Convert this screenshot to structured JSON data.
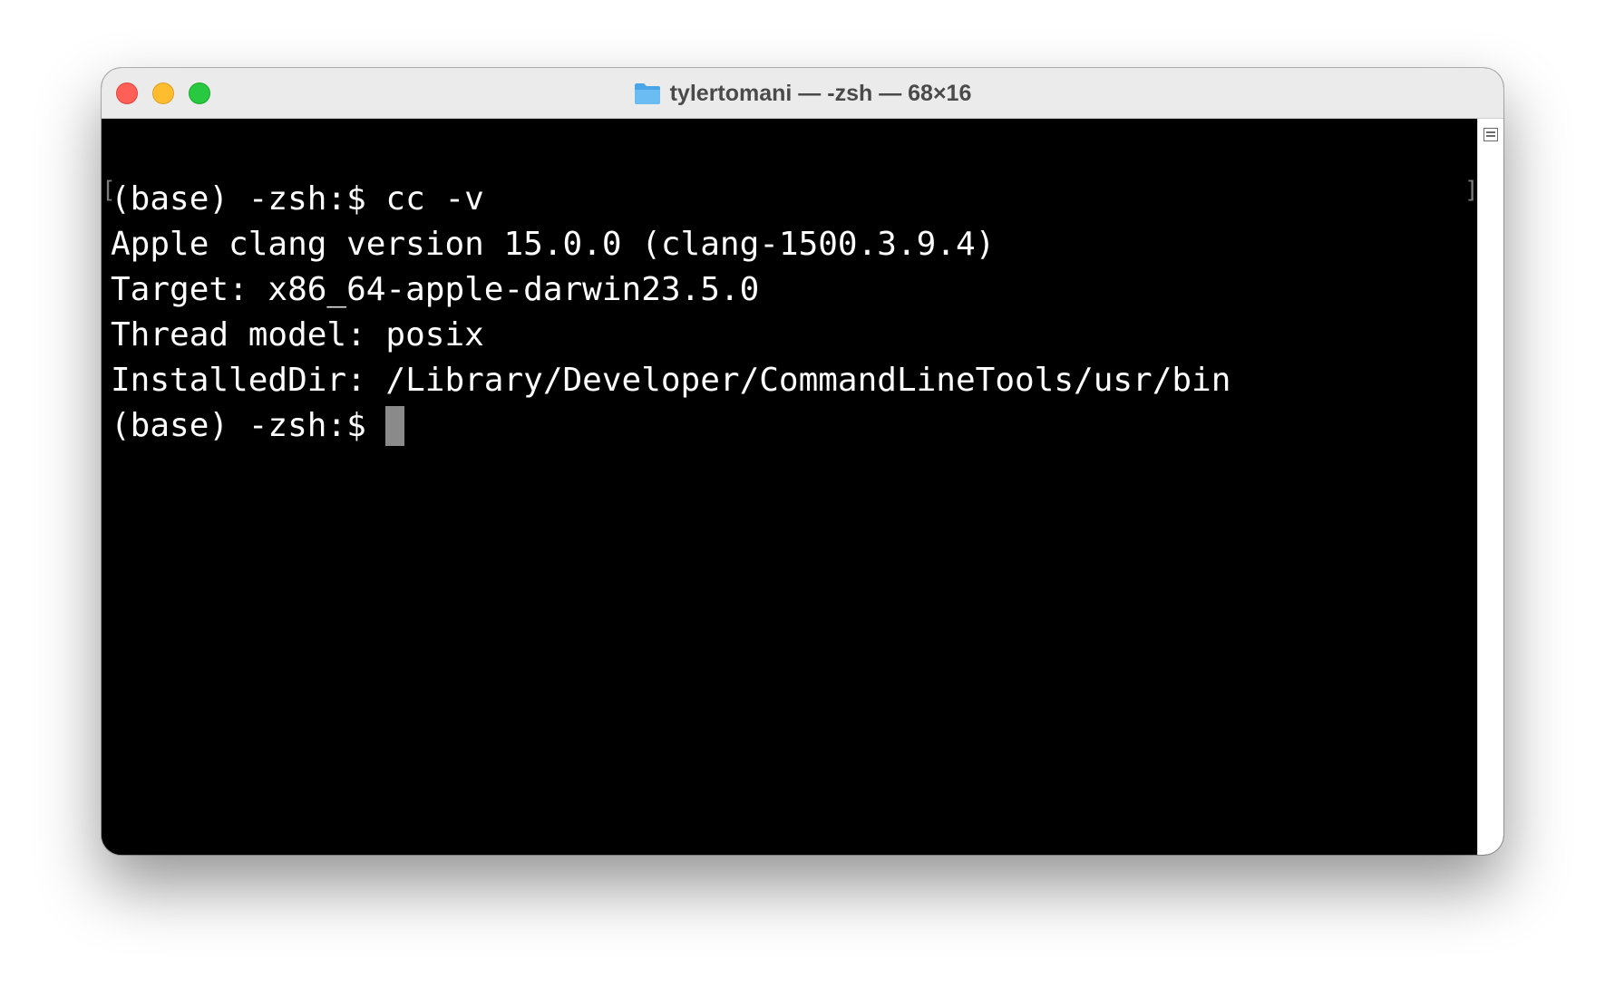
{
  "window": {
    "title": "tylertomani — -zsh — 68×16",
    "title_icon": "folder-icon",
    "controls": {
      "close_color": "#fe5f57",
      "minimize_color": "#febc2e",
      "zoom_color": "#28c840"
    }
  },
  "terminal": {
    "lines": [
      "(base) -zsh:$ cc -v",
      "Apple clang version 15.0.0 (clang-1500.3.9.4)",
      "Target: x86_64-apple-darwin23.5.0",
      "Thread model: posix",
      "InstalledDir: /Library/Developer/CommandLineTools/usr/bin"
    ],
    "prompt": "(base) -zsh:$ ",
    "background": "#000000",
    "foreground": "#ffffff",
    "cursor_color": "#8a8a8a"
  }
}
